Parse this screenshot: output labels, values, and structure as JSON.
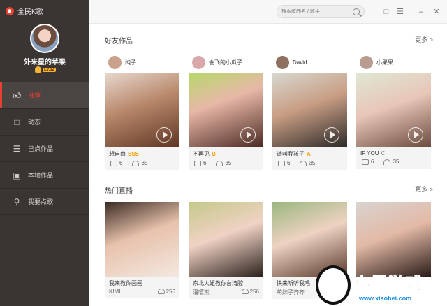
{
  "app": {
    "title": "全民K歌"
  },
  "profile": {
    "username": "外来星的苹果",
    "level": "LV.12"
  },
  "nav": [
    {
      "label": "推荐",
      "icon": "thumbs-up-icon",
      "active": true
    },
    {
      "label": "动态",
      "icon": "chat-bubble-icon",
      "active": false
    },
    {
      "label": "已点作品",
      "icon": "song-list-icon",
      "active": false
    },
    {
      "label": "本地作品",
      "icon": "monitor-icon",
      "active": false
    },
    {
      "label": "我要点歌",
      "icon": "microphone-icon",
      "active": false
    }
  ],
  "topbar": {
    "search_placeholder": "搜索歌曲名 / 歌手"
  },
  "friends": {
    "heading": "好友作品",
    "more": "更多 >",
    "cards": [
      {
        "user": "纯子",
        "song": "想自由",
        "grade": "SSS",
        "grade_color": "#f0a000",
        "comments": "6",
        "listens": "35"
      },
      {
        "user": "会飞的小瓜子",
        "song": "不再见",
        "grade": "B",
        "grade_color": "#f0a000",
        "comments": "6",
        "listens": "35"
      },
      {
        "user": "David",
        "song": "请叫我孩子",
        "grade": "A",
        "grade_color": "#f0a000",
        "comments": "6",
        "listens": "35"
      },
      {
        "user": "小果果",
        "song": "IF YOU",
        "grade": "C",
        "grade_color": "#999999",
        "comments": "6",
        "listens": "35"
      }
    ]
  },
  "live": {
    "heading": "热门直播",
    "more": "更多 >",
    "cards": [
      {
        "title": "我来教你画画",
        "host": "KIMI",
        "viewers": "256"
      },
      {
        "title": "东北大妞教你台湾腔",
        "host": "潘嘻熊",
        "viewers": "256"
      },
      {
        "title": "快来听听我唱",
        "host": "萌妹子齐齐",
        "viewers": ""
      },
      {
        "title": "",
        "host": "",
        "viewers": ""
      }
    ]
  },
  "watermark": {
    "text": "小黑游戏",
    "url": "www.xiaohei.com"
  }
}
